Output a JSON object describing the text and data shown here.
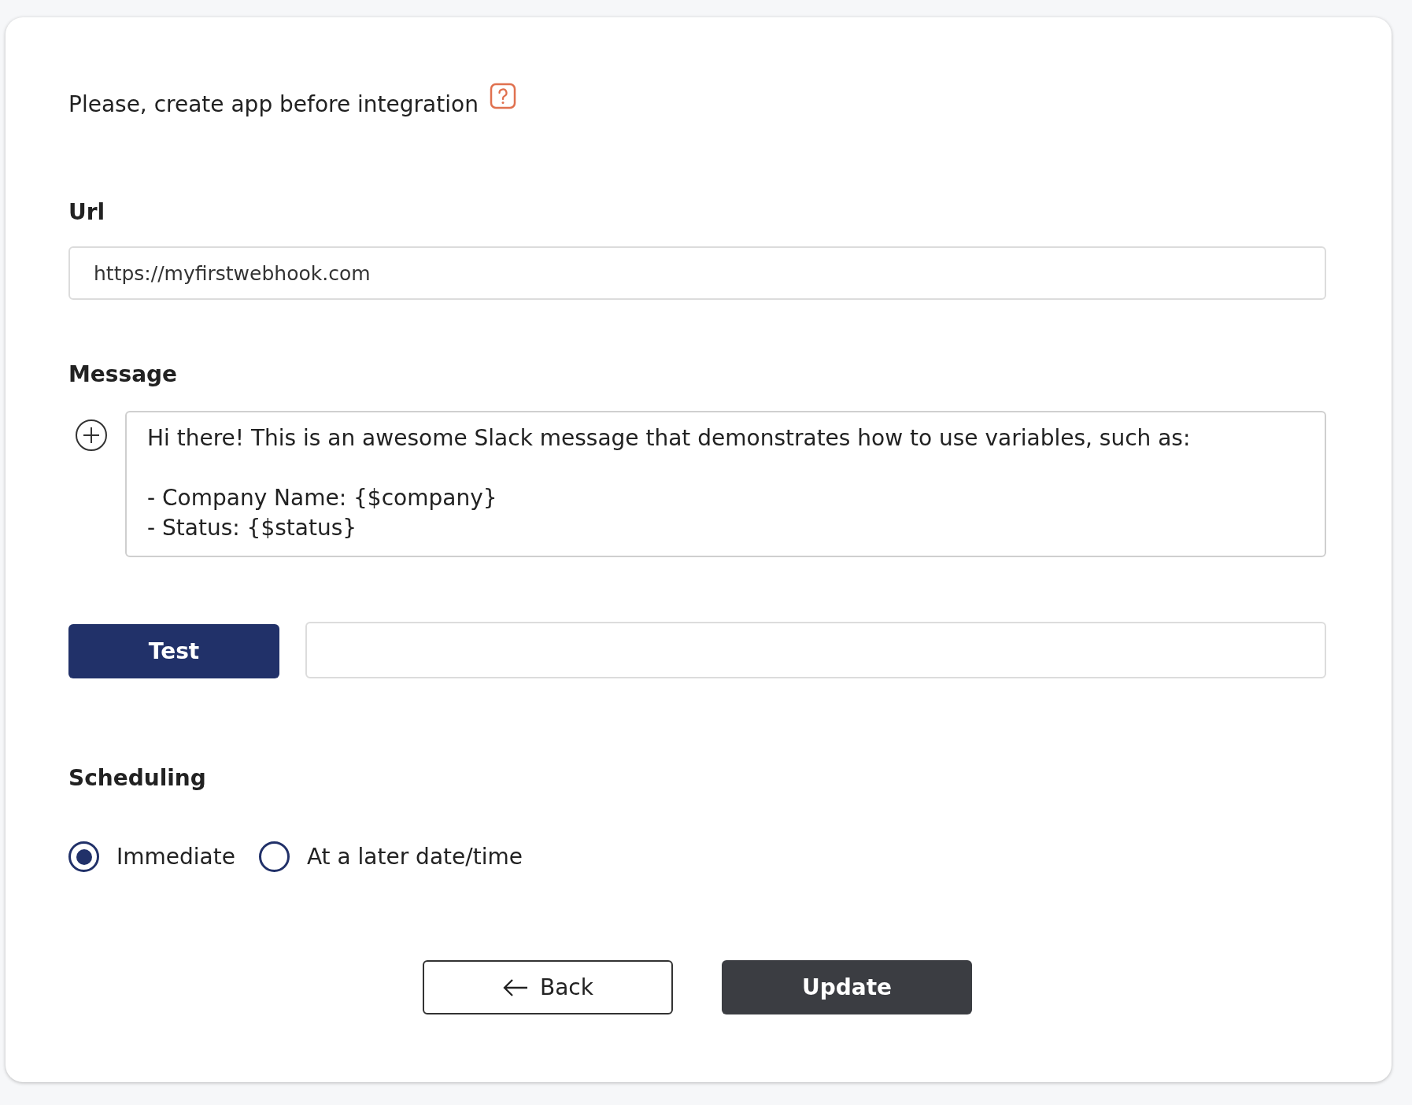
{
  "intro": {
    "text": "Please, create app before integration"
  },
  "url": {
    "label": "Url",
    "value": "https://myfirstwebhook.com"
  },
  "message": {
    "label": "Message",
    "value": "Hi there! This is an awesome Slack message that demonstrates how to use variables, such as:\n\n- Company Name: {$company}\n- Status: {$status}"
  },
  "test": {
    "button": "Test"
  },
  "scheduling": {
    "label": "Scheduling",
    "options": [
      {
        "label": "Immediate",
        "selected": true
      },
      {
        "label": "At a later date/time",
        "selected": false
      }
    ]
  },
  "actions": [
    {
      "label": "Back",
      "kind": "back"
    },
    {
      "label": "Update",
      "kind": "primary"
    }
  ]
}
